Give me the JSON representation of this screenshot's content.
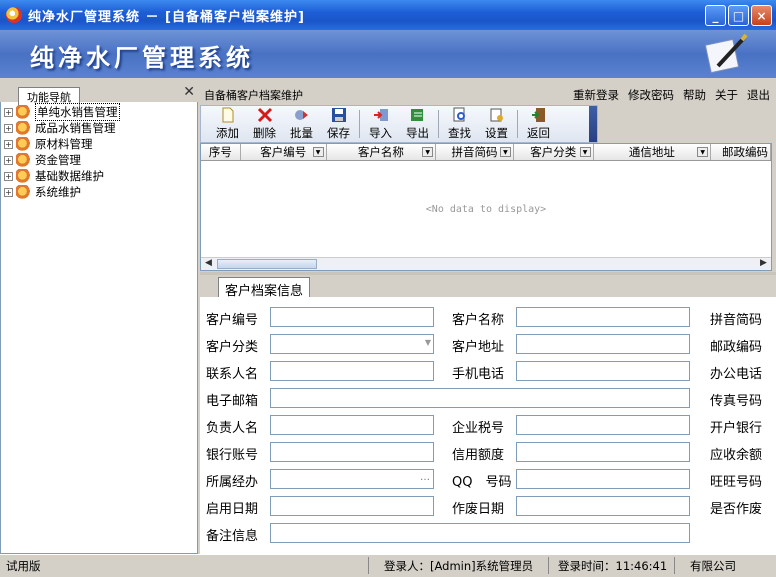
{
  "window": {
    "title": "纯净水厂管理系统 － [自备桶客户档案维护]"
  },
  "banner": {
    "brand": "纯净水厂管理系统"
  },
  "left": {
    "tab": "功能导航",
    "tree": [
      {
        "label": "单纯水销售管理"
      },
      {
        "label": "成品水销售管理"
      },
      {
        "label": "原材料管理"
      },
      {
        "label": "资金管理"
      },
      {
        "label": "基础数据维护"
      },
      {
        "label": "系统维护"
      }
    ]
  },
  "main": {
    "header_title": "自备桶客户档案维护",
    "menu": [
      "重新登录",
      "修改密码",
      "帮助",
      "关于",
      "退出"
    ],
    "toolbar": [
      "添加",
      "删除",
      "批量",
      "保存",
      "导入",
      "导出",
      "查找",
      "设置",
      "返回"
    ],
    "grid": {
      "columns": [
        "序号",
        "客户编号",
        "客户名称",
        "拼音简码",
        "客户分类",
        "通信地址",
        "邮政编码"
      ],
      "empty_text": "<No data to display>"
    },
    "form_tab": "客户档案信息",
    "form": {
      "col1": [
        "客户编号",
        "客户分类",
        "联系人名",
        "电子邮箱",
        "负责人名",
        "银行账号",
        "所属经办",
        "启用日期",
        "备注信息"
      ],
      "col2": [
        "客户名称",
        "客户地址",
        "手机电话",
        "",
        "企业税号",
        "信用额度",
        "QQ　号码",
        "作废日期"
      ],
      "col3": [
        "拼音简码",
        "邮政编码",
        "办公电话",
        "传真号码",
        "开户银行",
        "应收余额",
        "旺旺号码",
        "是否作废"
      ]
    }
  },
  "status": {
    "left": "试用版",
    "user": "登录人：[Admin]系统管理员",
    "time": "登录时间：11:46:41",
    "company": "有限公司"
  },
  "colors": {
    "titlebar": "#1e5fd6",
    "banner": "#4a72c4",
    "accent": "#3f5fa6"
  }
}
